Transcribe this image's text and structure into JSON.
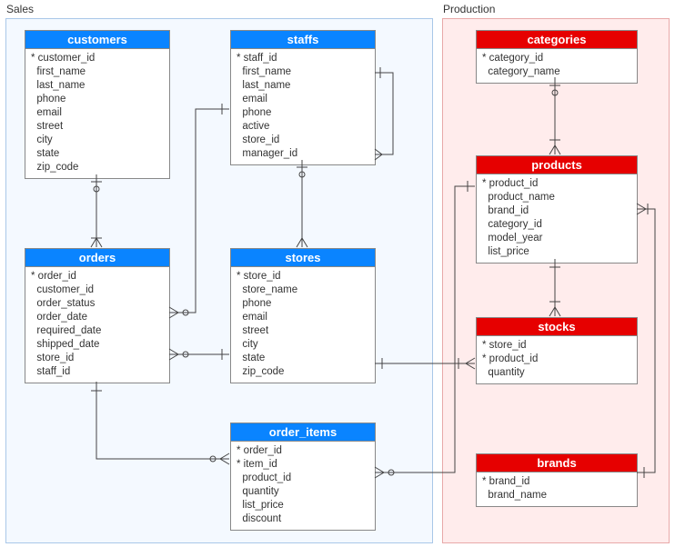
{
  "schemas": {
    "sales": {
      "label": "Sales"
    },
    "production": {
      "label": "Production"
    }
  },
  "entities": {
    "customers": {
      "title": "customers",
      "columns": [
        "* customer_id",
        "first_name",
        "last_name",
        "phone",
        "email",
        "street",
        "city",
        "state",
        "zip_code"
      ]
    },
    "staffs": {
      "title": "staffs",
      "columns": [
        "* staff_id",
        "first_name",
        "last_name",
        "email",
        "phone",
        "active",
        "store_id",
        "manager_id"
      ]
    },
    "orders": {
      "title": "orders",
      "columns": [
        "* order_id",
        "customer_id",
        "order_status",
        "order_date",
        "required_date",
        "shipped_date",
        "store_id",
        "staff_id"
      ]
    },
    "stores": {
      "title": "stores",
      "columns": [
        "* store_id",
        "store_name",
        "phone",
        "email",
        "street",
        "city",
        "state",
        "zip_code"
      ]
    },
    "order_items": {
      "title": "order_items",
      "columns": [
        "* order_id",
        "* item_id",
        "product_id",
        "quantity",
        "list_price",
        "discount"
      ]
    },
    "categories": {
      "title": "categories",
      "columns": [
        "* category_id",
        "category_name"
      ]
    },
    "products": {
      "title": "products",
      "columns": [
        "* product_id",
        "product_name",
        "brand_id",
        "category_id",
        "model_year",
        "list_price"
      ]
    },
    "stocks": {
      "title": "stocks",
      "columns": [
        "* store_id",
        "* product_id",
        "quantity"
      ]
    },
    "brands": {
      "title": "brands",
      "columns": [
        "* brand_id",
        "brand_name"
      ]
    }
  },
  "chart_data": {
    "type": "erd",
    "schemas": [
      {
        "name": "Sales",
        "entities": [
          "customers",
          "staffs",
          "orders",
          "stores",
          "order_items"
        ]
      },
      {
        "name": "Production",
        "entities": [
          "categories",
          "products",
          "stocks",
          "brands"
        ]
      }
    ],
    "relationships": [
      {
        "from": "customers.customer_id",
        "to": "orders.customer_id",
        "cardinality": "1..*"
      },
      {
        "from": "orders.order_id",
        "to": "order_items.order_id",
        "cardinality": "1..*"
      },
      {
        "from": "stores.store_id",
        "to": "orders.store_id",
        "cardinality": "1..*"
      },
      {
        "from": "staffs.staff_id",
        "to": "orders.staff_id",
        "cardinality": "1..*"
      },
      {
        "from": "stores.store_id",
        "to": "staffs.store_id",
        "cardinality": "1..*"
      },
      {
        "from": "staffs.manager_id",
        "to": "staffs.staff_id",
        "cardinality": "0..*"
      },
      {
        "from": "stores.store_id",
        "to": "stocks.store_id",
        "cardinality": "1..*"
      },
      {
        "from": "products.product_id",
        "to": "stocks.product_id",
        "cardinality": "1..*"
      },
      {
        "from": "products.product_id",
        "to": "order_items.product_id",
        "cardinality": "1..*"
      },
      {
        "from": "categories.category_id",
        "to": "products.category_id",
        "cardinality": "1..*"
      },
      {
        "from": "brands.brand_id",
        "to": "products.brand_id",
        "cardinality": "1..*"
      }
    ]
  }
}
